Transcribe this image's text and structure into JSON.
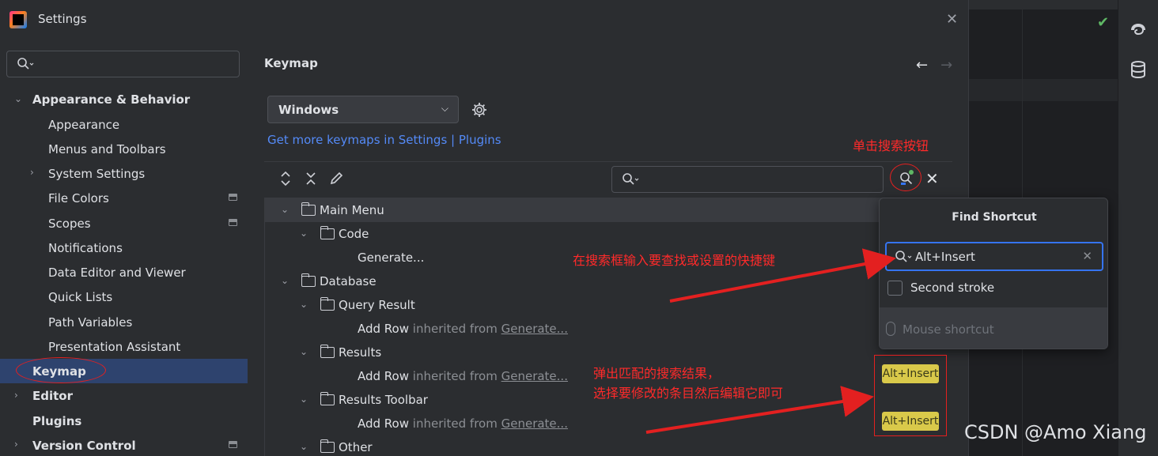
{
  "window": {
    "title": "Settings"
  },
  "sidebar": {
    "items": [
      {
        "label": "Appearance & Behavior",
        "bold": true,
        "chevron": "down"
      },
      {
        "label": "Appearance"
      },
      {
        "label": "Menus and Toolbars"
      },
      {
        "label": "System Settings",
        "chevron": "right"
      },
      {
        "label": "File Colors",
        "badge": true
      },
      {
        "label": "Scopes",
        "badge": true
      },
      {
        "label": "Notifications"
      },
      {
        "label": "Data Editor and Viewer"
      },
      {
        "label": "Quick Lists"
      },
      {
        "label": "Path Variables"
      },
      {
        "label": "Presentation Assistant"
      },
      {
        "label": "Keymap",
        "bold": true,
        "selected": true
      },
      {
        "label": "Editor",
        "bold": true,
        "chevron": "right"
      },
      {
        "label": "Plugins",
        "bold": true
      },
      {
        "label": "Version Control",
        "bold": true,
        "chevron": "right",
        "badge": true
      }
    ]
  },
  "main": {
    "title": "Keymap",
    "keymap_select": "Windows",
    "link_settings": "Get more keymaps in Settings",
    "link_sep": " | ",
    "link_plugins": "Plugins",
    "tree": [
      {
        "label": "Main Menu"
      },
      {
        "label": "Code"
      },
      {
        "label": "Generate..."
      },
      {
        "label": "Database"
      },
      {
        "label": "Query Result"
      },
      {
        "label": "Add Row",
        "inherited": " inherited from ",
        "source": "Generate..."
      },
      {
        "label": "Results"
      },
      {
        "label": "Add Row",
        "inherited": " inherited from ",
        "source": "Generate...",
        "shortcut": "Alt+Insert"
      },
      {
        "label": "Results Toolbar"
      },
      {
        "label": "Add Row",
        "inherited": " inherited from ",
        "source": "Generate...",
        "shortcut": "Alt+Insert"
      },
      {
        "label": "Other"
      }
    ]
  },
  "popup": {
    "title": "Find Shortcut",
    "input_value": "Alt+Insert",
    "second_stroke": "Second stroke",
    "mouse_shortcut": "Mouse shortcut"
  },
  "annotations": {
    "click_search": "单击搜索按钮",
    "type_shortcut": "在搜索框输入要查找或设置的快捷键",
    "result_line1": "弹出匹配的搜索结果，",
    "result_line2": "选择要修改的条目然后编辑它即可"
  },
  "watermark": "CSDN @Amo Xiang",
  "colors": {
    "accent": "#3574f0",
    "link": "#548af7",
    "selection": "#2e436e",
    "shortcut_badge": "#d9c94a",
    "annotation": "#ff2a2a"
  }
}
